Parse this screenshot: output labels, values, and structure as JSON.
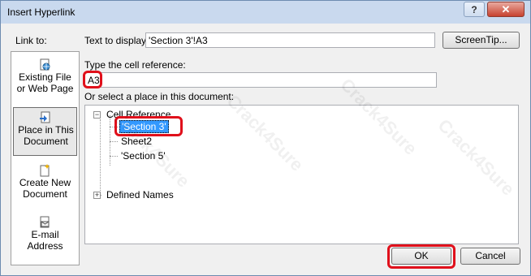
{
  "window": {
    "title": "Insert Hyperlink",
    "help_label": "?",
    "close_label": "✕"
  },
  "link_to": {
    "label": "Link to:",
    "items": [
      {
        "line1": "Existing File",
        "line2": "or Web Page",
        "icon": "globe-file-icon"
      },
      {
        "line1": "Place in This",
        "line2": "Document",
        "icon": "document-place-icon",
        "selected": true
      },
      {
        "line1": "Create New",
        "line2": "Document",
        "icon": "new-document-icon"
      },
      {
        "line1": "E-mail",
        "line2": "Address",
        "icon": "email-icon"
      }
    ]
  },
  "text_to_display": {
    "label": "Text to display:",
    "value": "'Section 3'!A3"
  },
  "screentip_label": "ScreenTip...",
  "cell_reference": {
    "label": "Type the cell reference:",
    "value": "A3"
  },
  "place": {
    "label": "Or select a place in this document:",
    "nodes": {
      "cell_reference": "Cell Reference",
      "section3": "'Section 3'",
      "sheet2": "Sheet2",
      "section5": "'Section 5'",
      "defined_names": "Defined Names"
    },
    "cell_reference_expander": "−",
    "defined_names_expander": "+"
  },
  "buttons": {
    "ok": "OK",
    "cancel": "Cancel"
  },
  "watermark_text": "Crack4Sure",
  "colors": {
    "highlight": "#e0101b",
    "selection": "#3399ff"
  }
}
